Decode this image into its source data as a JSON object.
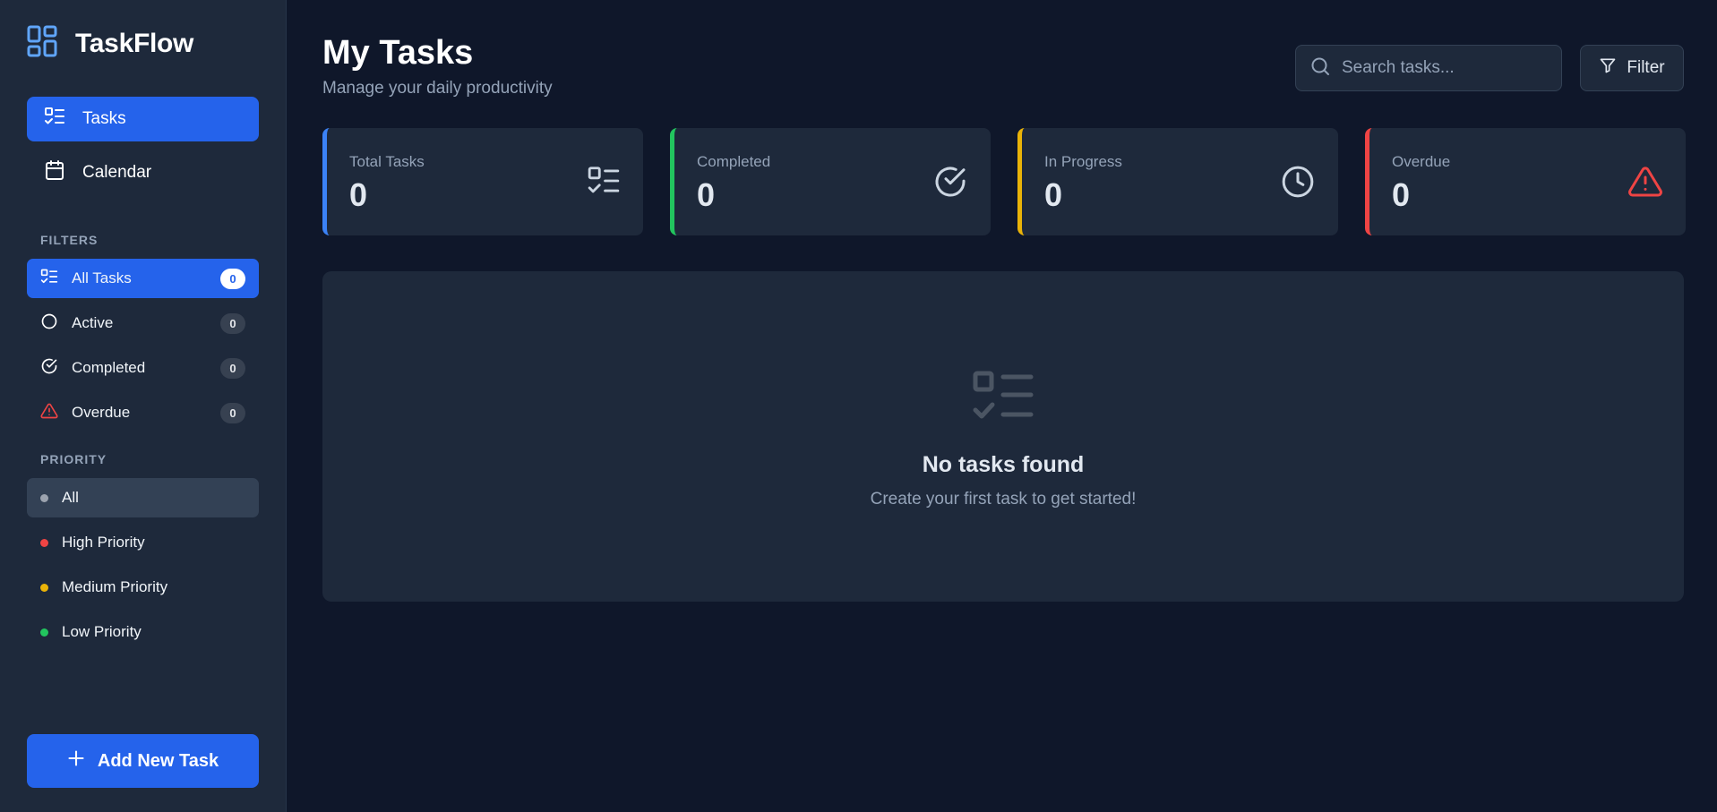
{
  "app": {
    "name": "TaskFlow"
  },
  "nav": [
    {
      "label": "Tasks",
      "icon": "tasks-list-icon",
      "active": true
    },
    {
      "label": "Calendar",
      "icon": "calendar-icon",
      "active": false
    }
  ],
  "filters": {
    "heading": "FILTERS",
    "items": [
      {
        "label": "All Tasks",
        "count": "0",
        "icon": "tasks-list-icon",
        "active": true
      },
      {
        "label": "Active",
        "count": "0",
        "icon": "circle-icon",
        "active": false
      },
      {
        "label": "Completed",
        "count": "0",
        "icon": "check-circle-icon",
        "active": false
      },
      {
        "label": "Overdue",
        "count": "0",
        "icon": "warning-icon",
        "active": false
      }
    ]
  },
  "priority": {
    "heading": "PRIORITY",
    "items": [
      {
        "label": "All",
        "color": "#9ca3af",
        "active": true
      },
      {
        "label": "High Priority",
        "color": "#ef4444",
        "active": false
      },
      {
        "label": "Medium Priority",
        "color": "#eab308",
        "active": false
      },
      {
        "label": "Low Priority",
        "color": "#22c55e",
        "active": false
      }
    ]
  },
  "add_button": {
    "label": "Add New Task"
  },
  "header": {
    "title": "My Tasks",
    "subtitle": "Manage your daily productivity",
    "search_placeholder": "Search tasks...",
    "filter_label": "Filter"
  },
  "stats": [
    {
      "label": "Total Tasks",
      "value": "0",
      "color": "#3b82f6",
      "icon": "tasks-list-icon"
    },
    {
      "label": "Completed",
      "value": "0",
      "color": "#22c55e",
      "icon": "check-circle-icon"
    },
    {
      "label": "In Progress",
      "value": "0",
      "color": "#eab308",
      "icon": "clock-icon"
    },
    {
      "label": "Overdue",
      "value": "0",
      "color": "#ef4444",
      "icon": "warning-icon"
    }
  ],
  "empty_state": {
    "title": "No tasks found",
    "subtitle": "Create your first task to get started!"
  }
}
